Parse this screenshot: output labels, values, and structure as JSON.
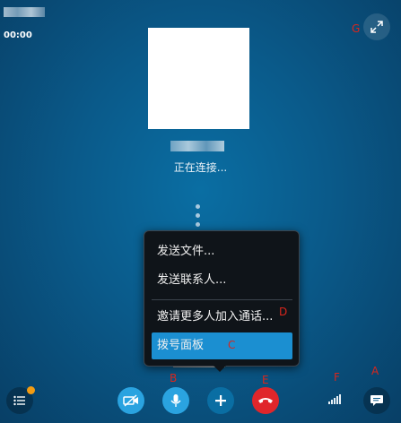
{
  "header": {
    "timer": "00:00"
  },
  "call": {
    "status": "正在连接..."
  },
  "menu": {
    "items": [
      "发送文件...",
      "发送联系人...",
      "邀请更多人加入通话...",
      "拨号面板"
    ],
    "selected_index": 3,
    "selected_color": "#1b8fd1"
  },
  "annotations": {
    "A": "A",
    "B": "B",
    "C": "C",
    "D": "D",
    "E": "E",
    "F": "F",
    "G": "G"
  },
  "controls": {
    "video_off_icon": "video-off-icon",
    "mic_icon": "mic-icon",
    "add_icon": "plus-icon",
    "hangup_icon": "hangup-icon",
    "signal_icon": "signal-icon",
    "chat_icon": "chat-icon",
    "participants_icon": "participants-list-icon",
    "expand_icon": "expand-icon"
  },
  "colors": {
    "hangup": "#e0262b",
    "call_button": "#2aa3e0",
    "badge": "#f39c12",
    "label": "#d9261c"
  }
}
